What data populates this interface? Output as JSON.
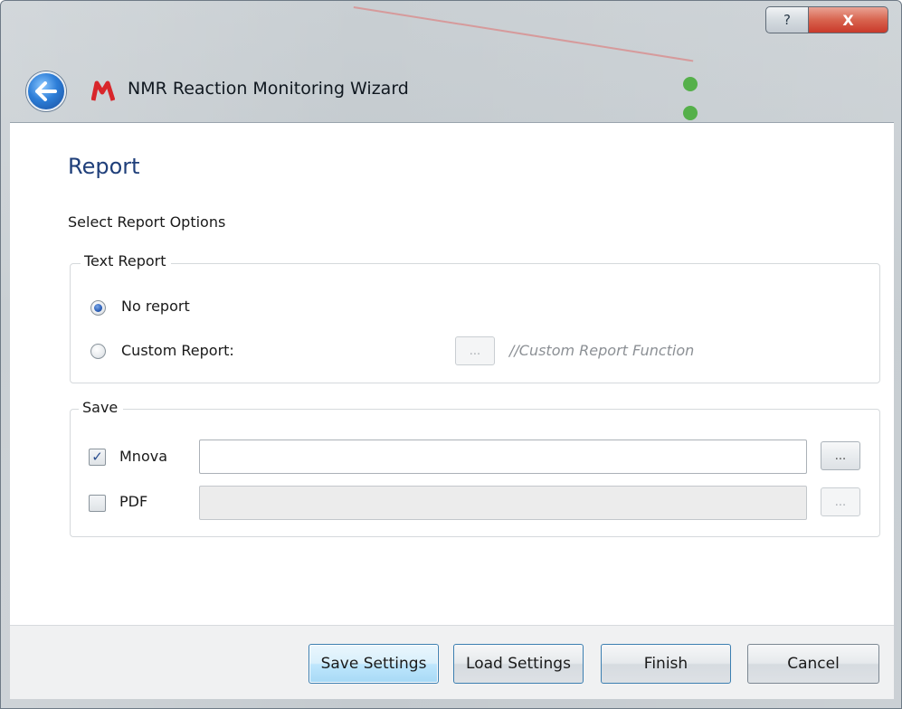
{
  "window": {
    "title": "NMR Reaction Monitoring Wizard",
    "help_label": "?",
    "close_label": "X"
  },
  "page": {
    "title": "Report",
    "subtitle": "Select Report Options"
  },
  "text_report": {
    "legend": "Text Report",
    "options": [
      {
        "label": "No report",
        "selected": true
      },
      {
        "label": "Custom Report:",
        "selected": false
      }
    ],
    "browse_label": "...",
    "function_hint": "//Custom Report Function"
  },
  "save": {
    "legend": "Save",
    "items": [
      {
        "label": "Mnova",
        "checked": true,
        "value": "",
        "browse_label": "..."
      },
      {
        "label": "PDF",
        "checked": false,
        "value": "",
        "browse_label": "..."
      }
    ]
  },
  "buttons": {
    "save_settings": "Save Settings",
    "load_settings": "Load Settings",
    "finish": "Finish",
    "cancel": "Cancel"
  },
  "colors": {
    "title_blue": "#1f3f7a",
    "close_red": "#c9392a",
    "hint_gray": "#8c9095"
  },
  "icons": [
    "back-arrow-icon",
    "mnova-logo-icon",
    "help-icon",
    "close-icon",
    "checkmark-icon"
  ]
}
